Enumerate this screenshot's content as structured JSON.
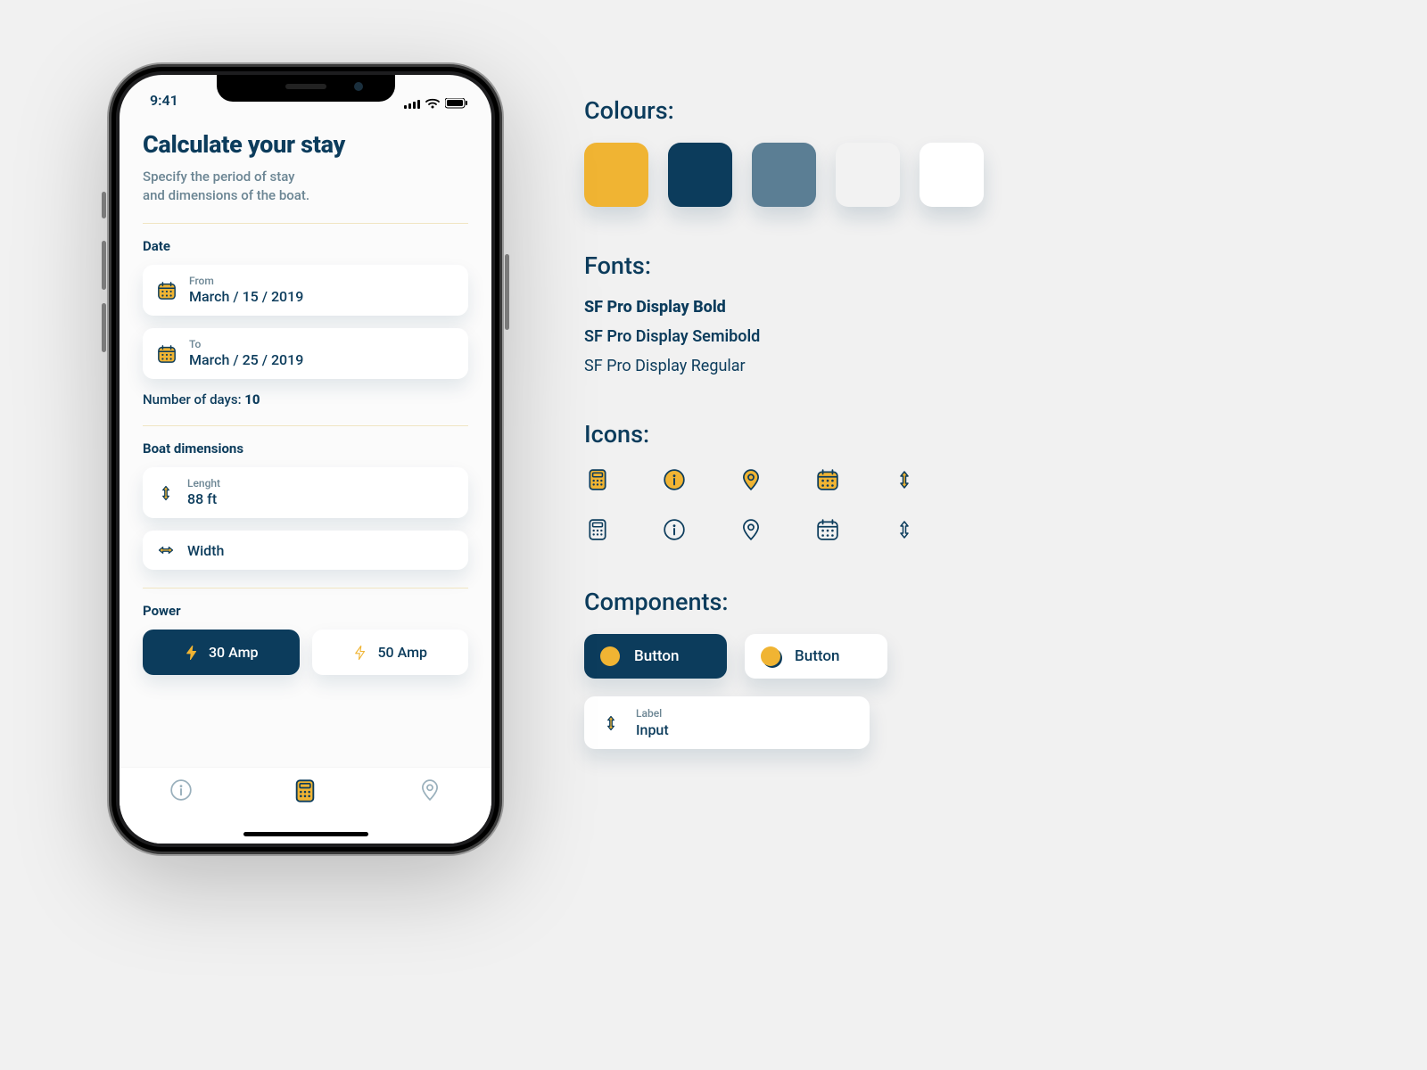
{
  "status_bar": {
    "time": "9:41"
  },
  "app": {
    "title": "Calculate your stay",
    "subtitle_l1": "Specify the period of stay",
    "subtitle_l2": "and dimensions of the boat.",
    "sections": {
      "date": {
        "label": "Date",
        "from": {
          "label": "From",
          "value": "March / 15 / 2019"
        },
        "to": {
          "label": "To",
          "value": "March / 25 / 2019"
        },
        "days_label": "Number of days: ",
        "days_value": "10"
      },
      "dimensions": {
        "label": "Boat dimensions",
        "length": {
          "label": "Lenght",
          "value": "88 ft"
        },
        "width": {
          "label": "Width",
          "value": ""
        }
      },
      "power": {
        "label": "Power",
        "options": [
          {
            "label": "30 Amp",
            "selected": true
          },
          {
            "label": "50 Amp",
            "selected": false
          }
        ]
      }
    }
  },
  "guide": {
    "colours_heading": "Colours:",
    "fonts_heading": "Fonts:",
    "icons_heading": "Icons:",
    "components_heading": "Components:",
    "colours": [
      "#F0B433",
      "#0C3C5C",
      "#5B7E94",
      "#F2F2F2",
      "#FFFFFF"
    ],
    "fonts": {
      "bold": "SF Pro Display Bold",
      "semibold": "SF Pro Display Semibold",
      "regular": "SF Pro Display Regular"
    },
    "components": {
      "button_primary_label": "Button",
      "button_secondary_label": "Button",
      "input_label": "Label",
      "input_value": "Input"
    }
  }
}
